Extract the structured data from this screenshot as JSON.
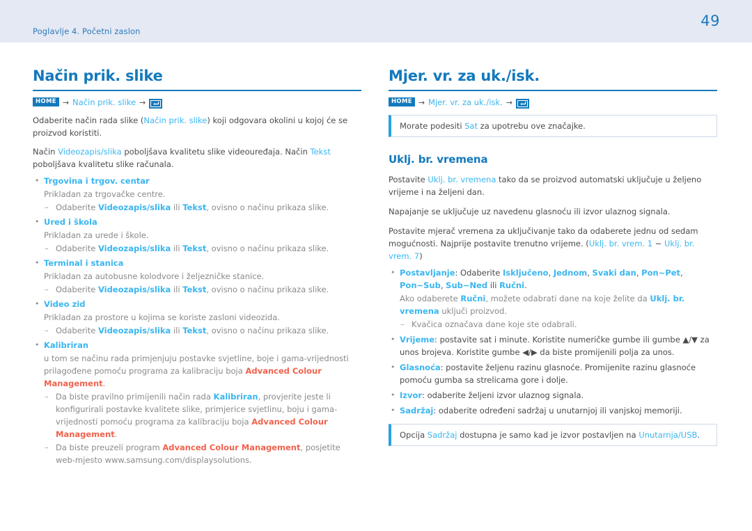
{
  "header": {
    "chapter": "Poglavlje 4. Početni zaslon",
    "page_number": "49",
    "band_color": "#e5e9f4",
    "accent_color": "#1479bc",
    "link_color": "#3ab6f0",
    "highlight_color": "#f0624d"
  },
  "left": {
    "title": "Način prik. slike",
    "breadcrumb": {
      "home_label": "HOME",
      "arrow": "→",
      "crumb": "Način prik. slike",
      "icon": "enter-key-icon"
    },
    "intro1": {
      "a": "Odaberite način rada slike (",
      "link": "Način prik. slike",
      "b": ") koji odgovara okolini u kojoj će se proizvod koristiti."
    },
    "intro2": {
      "a": "Način ",
      "link1": "Videozapis/slika",
      "b": " poboljšava kvalitetu slike videouređaja. Način ",
      "link2": "Tekst",
      "c": " poboljšava kvalitetu slike računala."
    },
    "sub_common": {
      "a": "Odaberite ",
      "link1": "Videozapis/slika",
      "b": " ili ",
      "link2": "Tekst",
      "c": ", ovisno o načinu prikaza slike."
    },
    "items": [
      {
        "head": "Trgovina i trgov. centar",
        "desc": "Prikladan za trgovačke centre.",
        "has_common_sub": true
      },
      {
        "head": "Ured i škola",
        "desc": "Prikladan za urede i škole.",
        "has_common_sub": true
      },
      {
        "head": "Terminal i stanica",
        "desc": "Prikladan za autobusne kolodvore i željezničke stanice.",
        "has_common_sub": true
      },
      {
        "head": "Video zid",
        "desc": "Prikladan za prostore u kojima se koriste zasloni videozida.",
        "has_common_sub": true
      }
    ],
    "calibrated": {
      "head": "Kalibriran",
      "desc_a": "u tom se načinu rada primjenjuju postavke svjetline, boje i gama-vrijednosti prilagođene pomoću programa za kalibraciju boja ",
      "desc_brand": "Advanced Colour Management",
      "desc_b": ".",
      "sub1_a": "Da biste pravilno primijenili način rada ",
      "sub1_link": "Kalibriran",
      "sub1_b": ", provjerite jeste li konfigurirali postavke kvalitete slike, primjerice svjetlinu, boju i gama-vrijednosti pomoću programa za kalibraciju boja ",
      "sub1_brand": "Advanced Colour Management",
      "sub1_c": ".",
      "sub2_a": "Da biste preuzeli program ",
      "sub2_brand": "Advanced Colour Management",
      "sub2_b": ", posjetite web-mjesto www.samsung.com/displaysolutions."
    }
  },
  "right": {
    "title": "Mjer. vr. za uk./isk.",
    "breadcrumb": {
      "home_label": "HOME",
      "arrow": "→",
      "crumb": "Mjer. vr. za uk./isk.",
      "icon": "enter-key-icon"
    },
    "note_top": {
      "a": "Morate podesiti ",
      "link": "Sat",
      "b": " za upotrebu ove značajke."
    },
    "sub_title": "Uklj. br. vremena",
    "p1": {
      "a": "Postavite ",
      "link": "Uklj. br. vremena",
      "b": " tako da se proizvod automatski uključuje u željeno vrijeme i na željeni dan."
    },
    "p2": "Napajanje se uključuje uz navedenu glasnoću ili izvor ulaznog signala.",
    "p3": {
      "a": "Postavite mjerač vremena za uključivanje tako da odaberete jednu od sedam mogućnosti. Najprije postavite trenutno vrijeme. (",
      "link1": "Uklj. br. vrem. 1",
      "tilde": " ~ ",
      "link2": "Uklj. br. vrem. 7",
      "b": ")"
    },
    "items": [
      {
        "head": "Postavljanje",
        "body_a": ": Odaberite ",
        "options": [
          "Isključeno",
          "Jednom",
          "Svaki dan",
          "Pon~Pet",
          "Pon~Sub",
          "Sub~Ned"
        ],
        "body_b": " ili ",
        "last_option": "Ručni",
        "body_c": ".",
        "sub_a": "Ako odaberete ",
        "sub_link1": "Ručni",
        "sub_b": ", možete odabrati dane na koje želite da ",
        "sub_link2": "Uklj. br. vremena",
        "sub_c": " uključi proizvod.",
        "dash": "Kvačica označava dane koje ste odabrali."
      },
      {
        "head": "Vrijeme",
        "body": ": postavite sat i minute. Koristite numeričke gumbe ili gumbe ▲/▼ za unos brojeva. Koristite gumbe ◀/▶ da biste promijenili polja za unos."
      },
      {
        "head": "Glasnoća",
        "body": ": postavite željenu razinu glasnoće. Promijenite razinu glasnoće pomoću gumba sa strelicama gore i dolje."
      },
      {
        "head": "Izvor",
        "body": ": odaberite željeni izvor ulaznog signala."
      },
      {
        "head": "Sadržaj",
        "body": ": odaberite određeni sadržaj u unutarnjoj ili vanjskoj memoriji."
      }
    ],
    "note_bottom": {
      "a": "Opcija ",
      "link1": "Sadržaj",
      "b": " dostupna je samo kad je izvor postavljen na ",
      "link2": "Unutarnja/USB",
      "c": "."
    }
  }
}
